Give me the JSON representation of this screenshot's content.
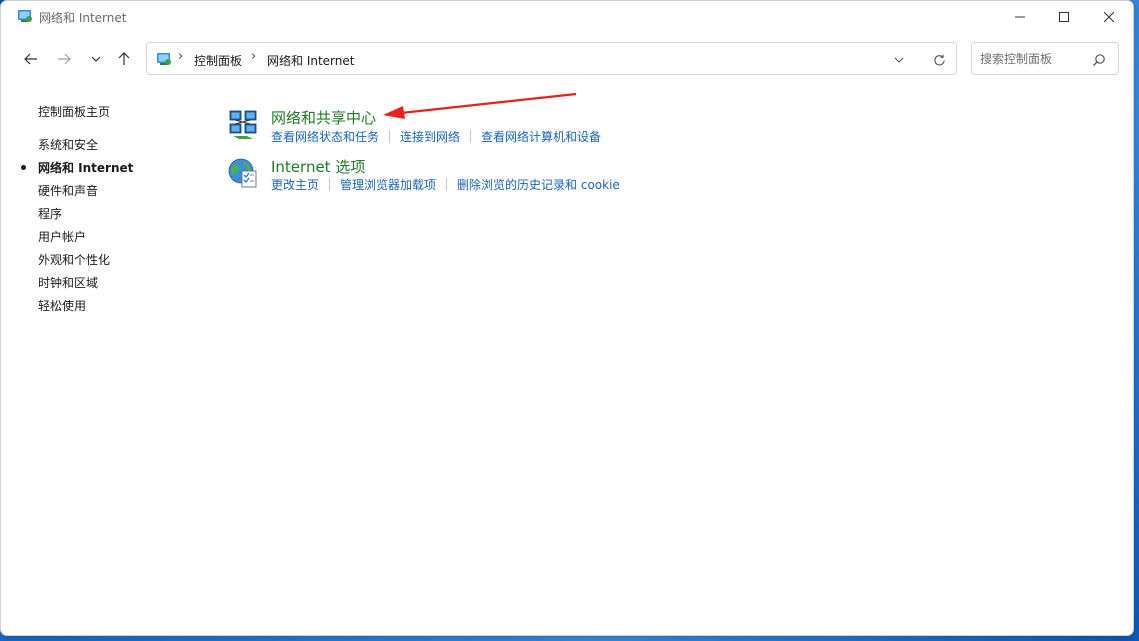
{
  "window": {
    "title": "网络和 Internet"
  },
  "address_bar": {
    "crumbs": [
      "控制面板",
      "网络和 Internet"
    ]
  },
  "search": {
    "placeholder": "搜索控制面板"
  },
  "sidebar": {
    "items": [
      {
        "label": "控制面板主页",
        "active": false
      },
      {
        "label": "系统和安全",
        "active": false
      },
      {
        "label": "网络和 Internet",
        "active": true
      },
      {
        "label": "硬件和声音",
        "active": false
      },
      {
        "label": "程序",
        "active": false
      },
      {
        "label": "用户帐户",
        "active": false
      },
      {
        "label": "外观和个性化",
        "active": false
      },
      {
        "label": "时钟和区域",
        "active": false
      },
      {
        "label": "轻松使用",
        "active": false
      }
    ]
  },
  "categories": [
    {
      "title": "网络和共享中心",
      "icon": "network-sharing-center-icon",
      "tasks": [
        "查看网络状态和任务",
        "连接到网络",
        "查看网络计算机和设备"
      ]
    },
    {
      "title": "Internet 选项",
      "icon": "internet-options-icon",
      "tasks": [
        "更改主页",
        "管理浏览器加载项",
        "删除浏览的历史记录和 cookie"
      ]
    }
  ],
  "colors": {
    "category_title": "#1e7d24",
    "task_link": "#1a64b8",
    "annotation_arrow": "#e8221b",
    "desktop_background": "#1a6fd0"
  }
}
